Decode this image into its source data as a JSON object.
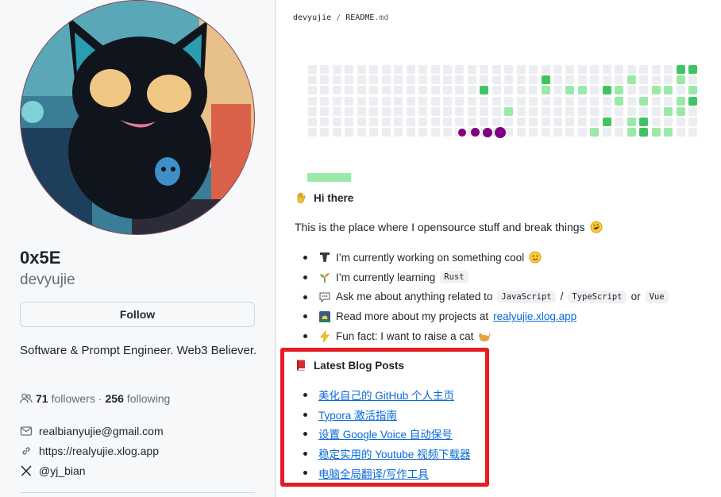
{
  "profile": {
    "display_name": "0x5E",
    "username": "devyujie",
    "follow_label": "Follow",
    "bio": "Software & Prompt Engineer. Web3 Believer.",
    "followers_count": "71",
    "followers_label": "followers",
    "separator": "·",
    "following_count": "256",
    "following_label": "following",
    "email": "realbianyujie@gmail.com",
    "website": "https://realyujie.xlog.app",
    "twitter": "@yj_bian"
  },
  "readme": {
    "breadcrumb": {
      "owner": "devyujie",
      "sep": "/",
      "file": "README",
      "ext": ".md"
    },
    "greeting": "Hi there",
    "intro": "This is the place where I opensource stuff and break things",
    "bullets": {
      "working": "I’m currently working on something cool",
      "learning": "I’m currently learning",
      "learning_code": "Rust",
      "ask": "Ask me about anything related to",
      "ask_code1": "JavaScript",
      "ask_slash": "/",
      "ask_code2": "TypeScript",
      "ask_or": "or",
      "ask_code3": "Vue",
      "projects": "Read more about my projects at",
      "projects_link": "realyujie.xlog.app",
      "funfact": "Fun fact: I want to raise a cat"
    },
    "blog_heading": "Latest Blog Posts",
    "blog_posts": [
      "美化自己的 GitHub 个人主页",
      "Typora 激活指南",
      "设置 Google Voice 自动保号",
      "稳定实用的 Youtube 视频下载器",
      "电脑全局翻译/写作工具"
    ]
  },
  "contribution_grid": {
    "empty_color": "#ebedf0",
    "green_color": "#9be9a8",
    "green_mid_color": "#40c463",
    "snake_color": "#800080",
    "highlight_color": "#e61c23"
  }
}
